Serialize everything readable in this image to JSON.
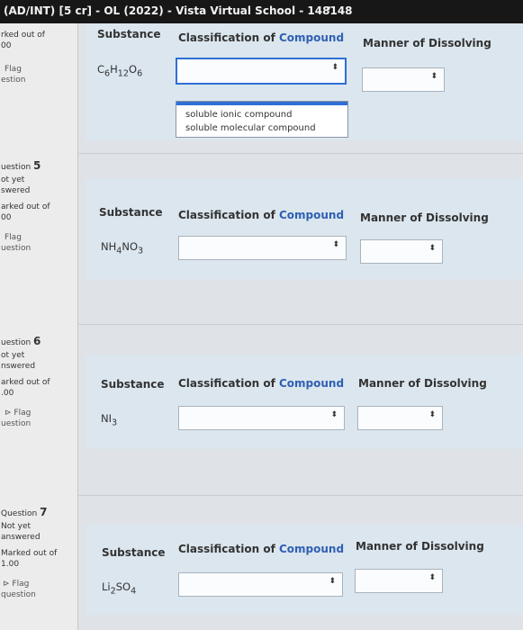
{
  "window": {
    "title": "(AD/INT) [5 cr] - OL (2022) - Vista Virtual School - 148148",
    "caret": "▾"
  },
  "sidebar": [
    {
      "number_prefix": "",
      "number": "",
      "status": "",
      "marked": "rked out of",
      "marked_value": "00",
      "flag": "Flag",
      "flag2": "estion"
    },
    {
      "number_prefix": "uestion ",
      "number": "5",
      "status": "ot yet",
      "status2": "swered",
      "marked": "arked out of",
      "marked_value": "00",
      "flag": "Flag",
      "flag2": "uestion"
    },
    {
      "number_prefix": "uestion ",
      "number": "6",
      "status": "ot yet",
      "status2": "nswered",
      "marked": "arked out of",
      "marked_value": ".00",
      "flag": "Flag",
      "flag2": "uestion"
    },
    {
      "number_prefix": "Question ",
      "number": "7",
      "status": "Not yet",
      "status2": "answered",
      "marked": "Marked out of",
      "marked_value": "1.00",
      "flag": "Flag",
      "flag2": "question"
    }
  ],
  "headers": {
    "substance": "Substance",
    "classification": "Classification of ",
    "compound": "Compound",
    "manner": "Manner of Dissolving"
  },
  "rows": [
    {
      "substance": "C6H12O6",
      "sub_html_parts": [
        "C",
        "6",
        "H",
        "12",
        "O",
        "6"
      ]
    },
    {
      "substance": "NH4NO3",
      "sub_html_parts": [
        "NH",
        "4",
        "NO",
        "3"
      ]
    },
    {
      "substance": "NI3",
      "sub_html_parts": [
        "NI",
        "3"
      ]
    },
    {
      "substance": "Li2SO4",
      "sub_html_parts": [
        "Li",
        "2",
        "SO",
        "4"
      ]
    }
  ],
  "dropdown": {
    "options": [
      "soluble ionic compound",
      "soluble molecular compound"
    ]
  },
  "select_arrow": "⬍"
}
